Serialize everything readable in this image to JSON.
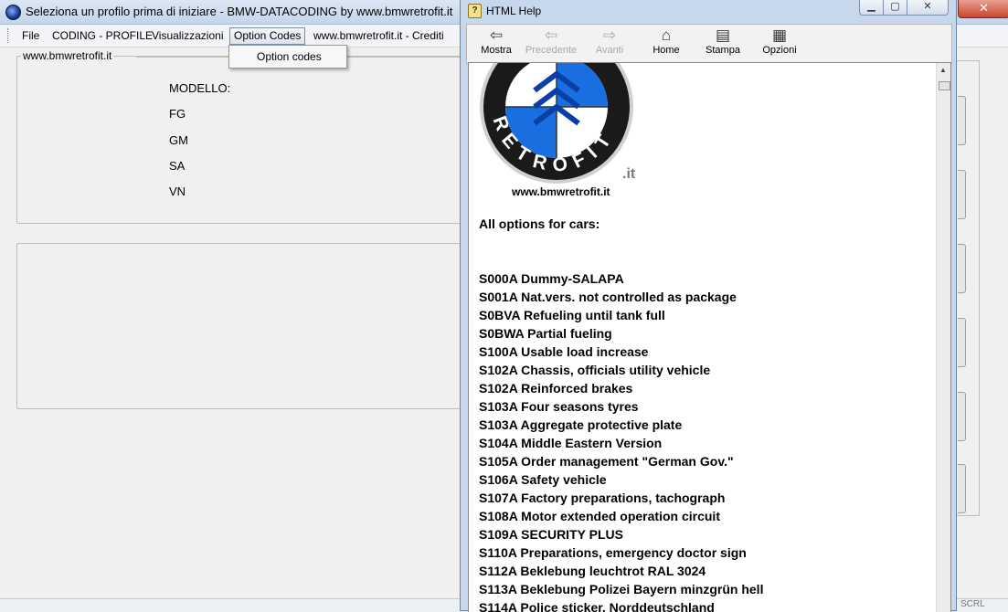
{
  "main_window": {
    "title": "Seleziona un profilo prima di iniziare - BMW-DATACODING by www.bmwretrofit.it",
    "menu": [
      "File",
      "CODING - PROFILE",
      "Visualizzazioni",
      "Option Codes",
      "www.bmwretrofit.it - Crediti"
    ],
    "dropdown_option": "Option codes",
    "groupbox_title": "www.bmwretrofit.it",
    "field_labels": [
      "MODELLO:",
      "FG",
      "GM",
      "SA",
      "VN"
    ],
    "status_text": "SCRL"
  },
  "help_window": {
    "title": "HTML Help",
    "toolbar": [
      {
        "label": "Mostra",
        "icon": "show-pane-icon",
        "enabled": true
      },
      {
        "label": "Precedente",
        "icon": "back-arrow-icon",
        "enabled": false
      },
      {
        "label": "Avanti",
        "icon": "forward-arrow-icon",
        "enabled": false
      },
      {
        "label": "Home",
        "icon": "home-icon",
        "enabled": true
      },
      {
        "label": "Stampa",
        "icon": "printer-icon",
        "enabled": true
      },
      {
        "label": "Opzioni",
        "icon": "options-icon",
        "enabled": true
      }
    ],
    "logo_letters": "RETROFIT",
    "logo_suffix": ".it",
    "logo_url": "www.bmwretrofit.it",
    "heading": "All options for cars:",
    "options": [
      "S000A Dummy-SALAPA",
      "S001A Nat.vers. not controlled as package",
      "S0BVA Refueling until tank full",
      "S0BWA Partial fueling",
      "S100A Usable load increase",
      "S102A Chassis, officials utility vehicle",
      "S102A Reinforced brakes",
      "S103A Four seasons tyres",
      "S103A Aggregate protective plate",
      "S104A Middle Eastern Version",
      "S105A Order management \"German Gov.\"",
      "S106A Safety vehicle",
      "S107A Factory preparations, tachograph",
      "S108A Motor extended operation circuit",
      "S109A SECURITY PLUS",
      "S110A Preparations, emergency doctor sign",
      "S112A Beklebung leuchtrot RAL 3024",
      "S113A Beklebung Polizei Bayern minzgrün hell",
      "S114A Police sticker, Norddeutschland"
    ]
  },
  "colors": {
    "logo_blue": "#1a6fe0",
    "logo_ring": "#1a1a1a",
    "accent": "#c7452e"
  }
}
